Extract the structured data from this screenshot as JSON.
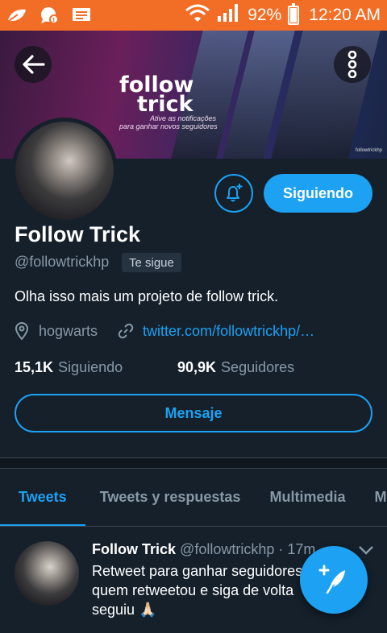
{
  "status_bar": {
    "battery_percent": "92%",
    "time": "12:20 AM",
    "icons": [
      "leaf-icon",
      "chat-bubble-icon",
      "message-icon",
      "wifi-icon",
      "signal-icon",
      "battery-icon"
    ]
  },
  "banner": {
    "title_line1": "follow",
    "title_line2": "trick",
    "subtitle_line1": "Ative as notificações",
    "subtitle_line2": "para ganhar novos seguidores",
    "watermark": "followtrickhp"
  },
  "profile": {
    "name": "Follow Trick",
    "handle": "@followtrickhp",
    "follows_you_badge": "Te sigue",
    "bio": "Olha isso mais um projeto de follow trick.",
    "location": "hogwarts",
    "url": "twitter.com/followtrickhp/…",
    "following_count": "15,1K",
    "following_label": "Siguiendo",
    "followers_count": "90,9K",
    "followers_label": "Seguidores",
    "follow_button_label": "Siguiendo",
    "message_button_label": "Mensaje"
  },
  "tabs": [
    {
      "label": "Tweets",
      "active": true
    },
    {
      "label": "Tweets y respuestas",
      "active": false
    },
    {
      "label": "Multimedia",
      "active": false
    },
    {
      "label": "Me gusta",
      "active": false
    }
  ],
  "tweet": {
    "name": "Follow Trick",
    "handle": "@followtrickhp",
    "time": "· 17m",
    "text_line1": "Retweet para ganhar seguidores,",
    "text_line2": "quem retweetou e siga de volta",
    "text_line3": "seguiu 🙏🏻"
  },
  "colors": {
    "accent": "#1da1f2",
    "background": "#15202b",
    "status_bar": "#f26e27",
    "muted_text": "#8899a6"
  }
}
